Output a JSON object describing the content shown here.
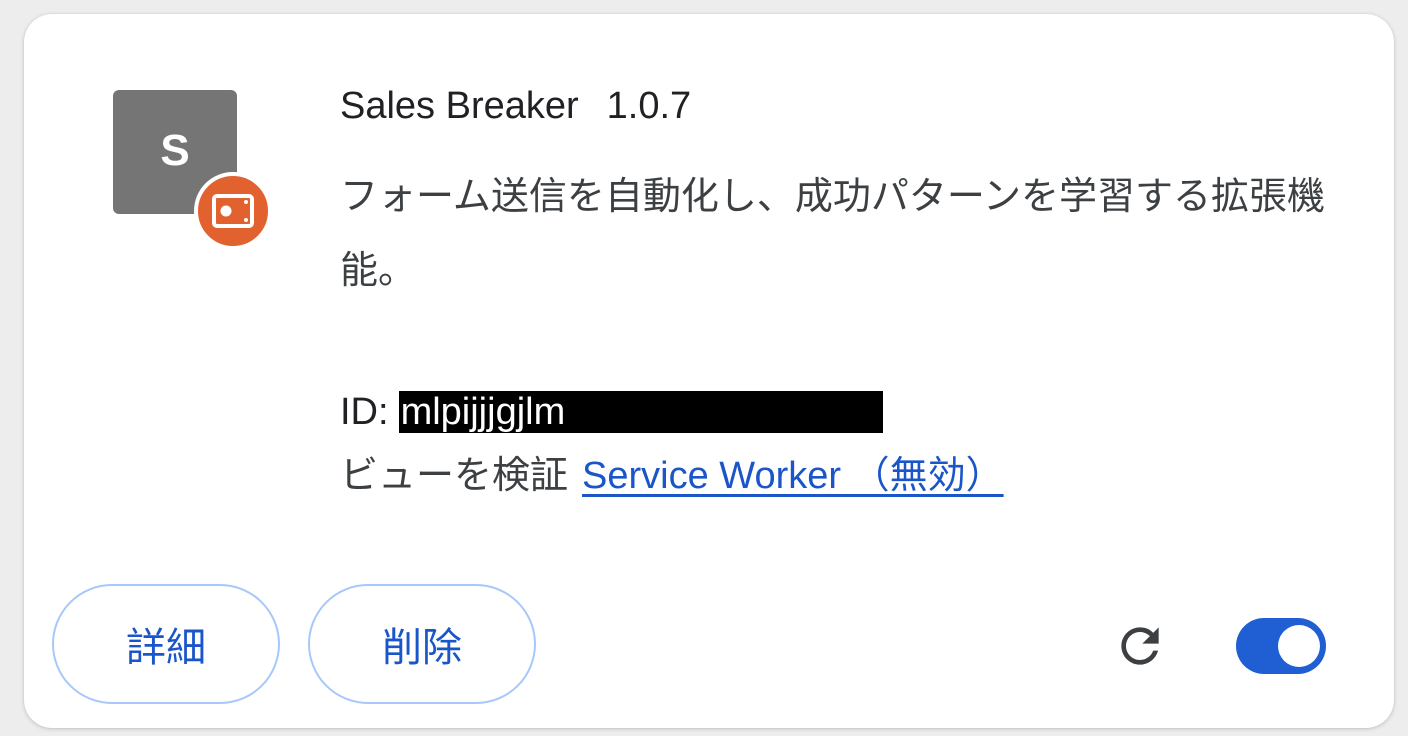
{
  "extension": {
    "icon_letter": "S",
    "name": "Sales Breaker",
    "version": "1.0.7",
    "description": "フォーム送信を自動化し、成功パターンを学習する拡張機能。",
    "id_label": "ID:",
    "id_value": "mlpijjjgjlm",
    "inspect_label": "ビューを検証",
    "service_worker_link": "Service Worker （無効）",
    "enabled": true
  },
  "buttons": {
    "details": "詳細",
    "remove": "削除"
  },
  "icons": {
    "badge": "developer-mode-badge-icon",
    "reload": "reload-icon"
  },
  "colors": {
    "accent": "#1f5fd3",
    "link": "#1a56c9",
    "badge": "#e2622f",
    "icon_bg": "#757575",
    "pill_border": "#a8c7fa"
  }
}
